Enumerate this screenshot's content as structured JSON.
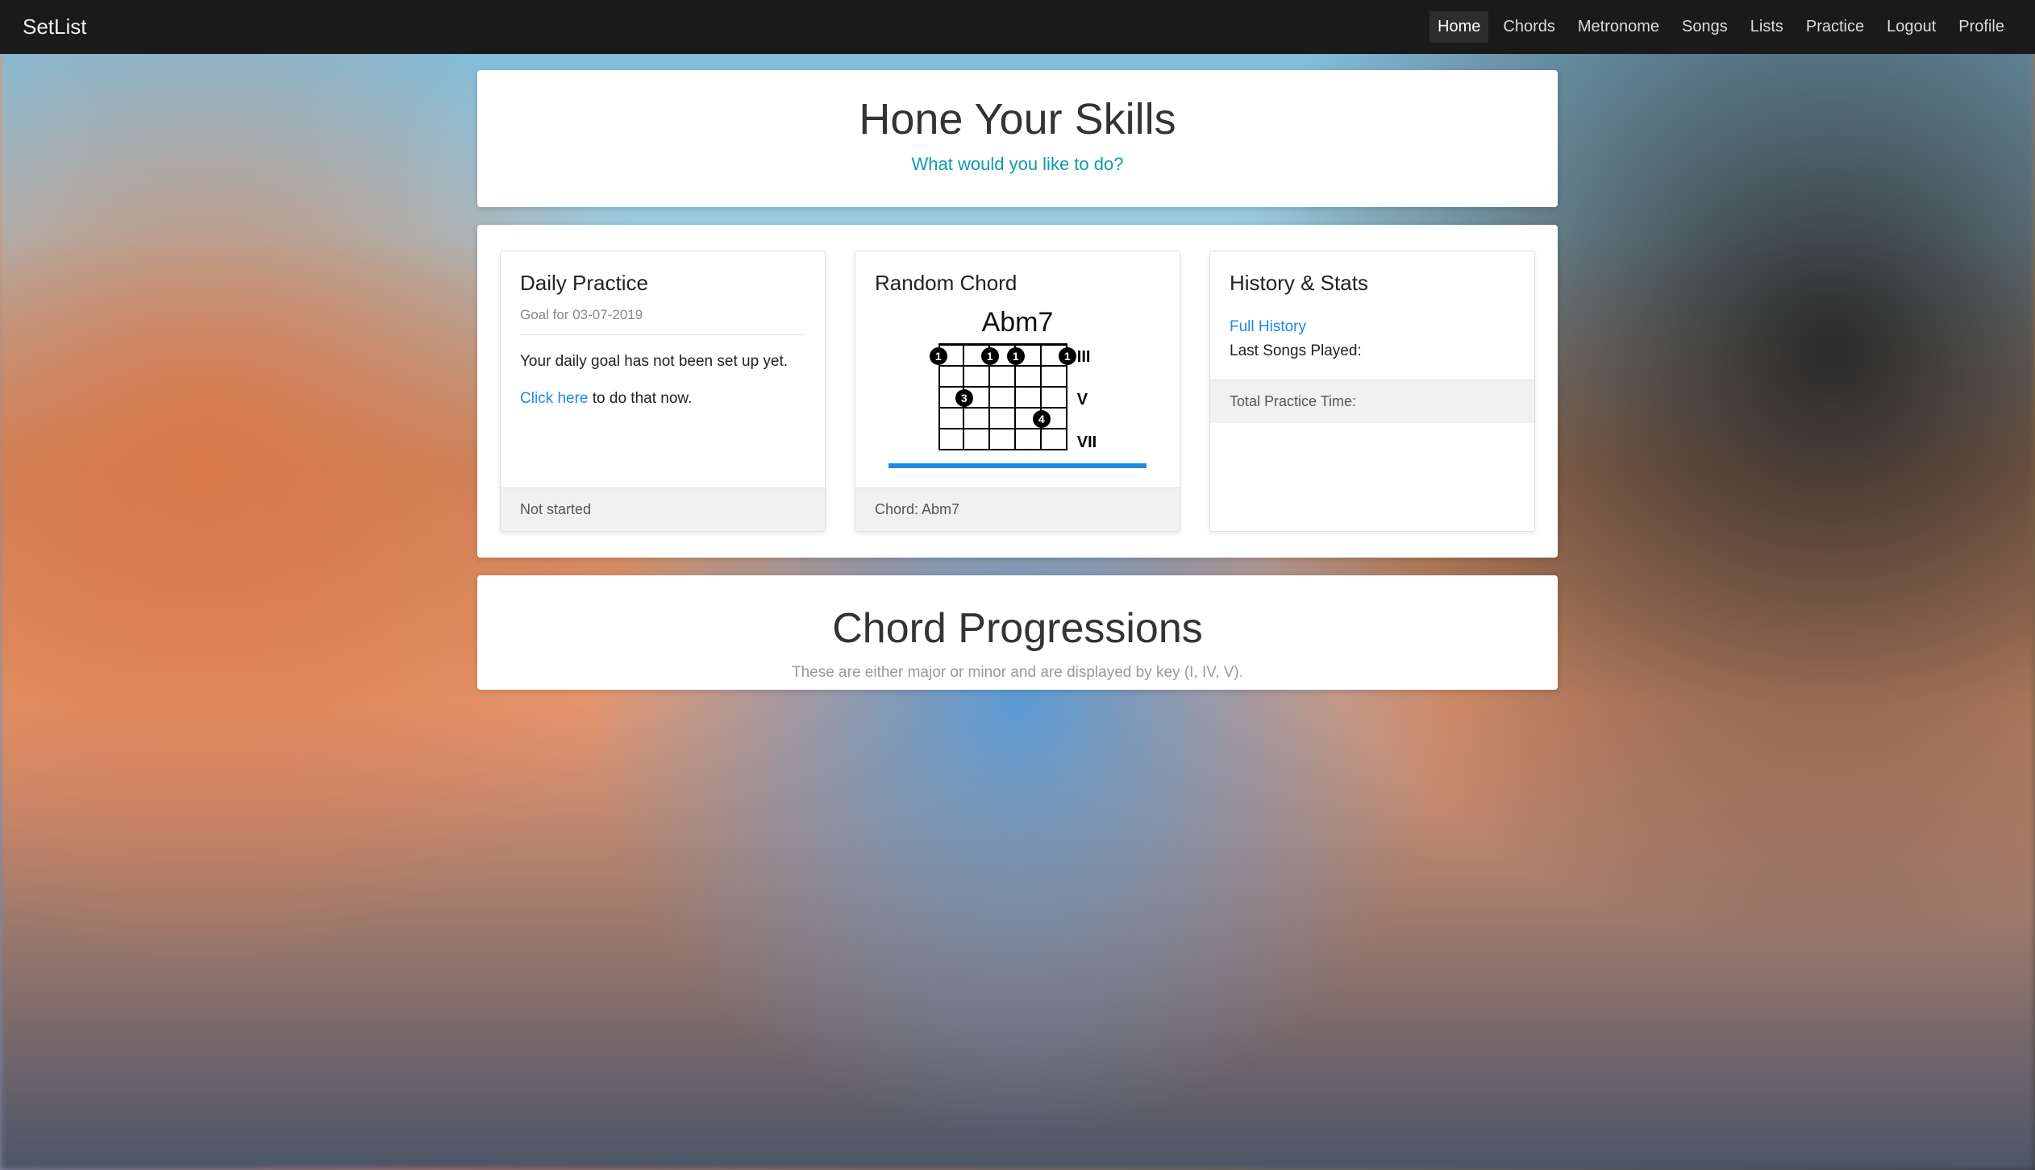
{
  "navbar": {
    "brand": "SetList",
    "links": [
      {
        "label": "Home",
        "active": true
      },
      {
        "label": "Chords",
        "active": false
      },
      {
        "label": "Metronome",
        "active": false
      },
      {
        "label": "Songs",
        "active": false
      },
      {
        "label": "Lists",
        "active": false
      },
      {
        "label": "Practice",
        "active": false
      },
      {
        "label": "Logout",
        "active": false
      },
      {
        "label": "Profile",
        "active": false
      }
    ]
  },
  "hero": {
    "title": "Hone Your Skills",
    "subtitle": "What would you like to do?"
  },
  "cards": {
    "daily": {
      "title": "Daily Practice",
      "subtitle": "Goal for 03-07-2019",
      "text": "Your daily goal has not been set up yet.",
      "link_text": "Click here",
      "link_suffix": " to do that now.",
      "footer": "Not started"
    },
    "random": {
      "title": "Random Chord",
      "chord_name": "Abm7",
      "fret_labels": [
        "III",
        "V",
        "VII"
      ],
      "fingers": [
        {
          "string": 0,
          "fret": 1,
          "num": "1"
        },
        {
          "string": 2,
          "fret": 1,
          "num": "1"
        },
        {
          "string": 3,
          "fret": 1,
          "num": "1"
        },
        {
          "string": 5,
          "fret": 1,
          "num": "1"
        },
        {
          "string": 1,
          "fret": 3,
          "num": "3"
        },
        {
          "string": 4,
          "fret": 4,
          "num": "4"
        }
      ],
      "footer": "Chord: Abm7"
    },
    "history": {
      "title": "History & Stats",
      "full_history_link": "Full History",
      "last_songs_label": "Last Songs Played:",
      "footer": "Total Practice Time:"
    }
  },
  "progressions": {
    "title": "Chord Progressions",
    "subtitle": "These are either major or minor and are displayed by key (I, IV, V)."
  }
}
